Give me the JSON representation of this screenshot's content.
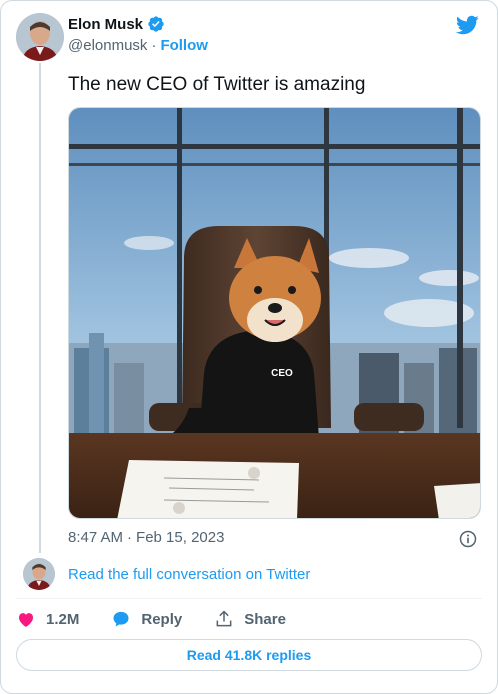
{
  "author": {
    "name": "Elon Musk",
    "handle": "@elonmusk",
    "separator": "·",
    "follow_label": "Follow"
  },
  "tweet": {
    "text": "The new CEO of Twitter is amazing",
    "media_label": "CEO",
    "timestamp_time": "8:47 AM",
    "timestamp_sep": "·",
    "timestamp_date": "Feb 15, 2023"
  },
  "conversation_link": "Read the full conversation on Twitter",
  "actions": {
    "likes": "1.2M",
    "reply_label": "Reply",
    "share_label": "Share"
  },
  "read_replies_label": "Read 41.8K replies",
  "colors": {
    "accent": "#1d9bf0",
    "like": "#f91880",
    "text_secondary": "#536471"
  }
}
